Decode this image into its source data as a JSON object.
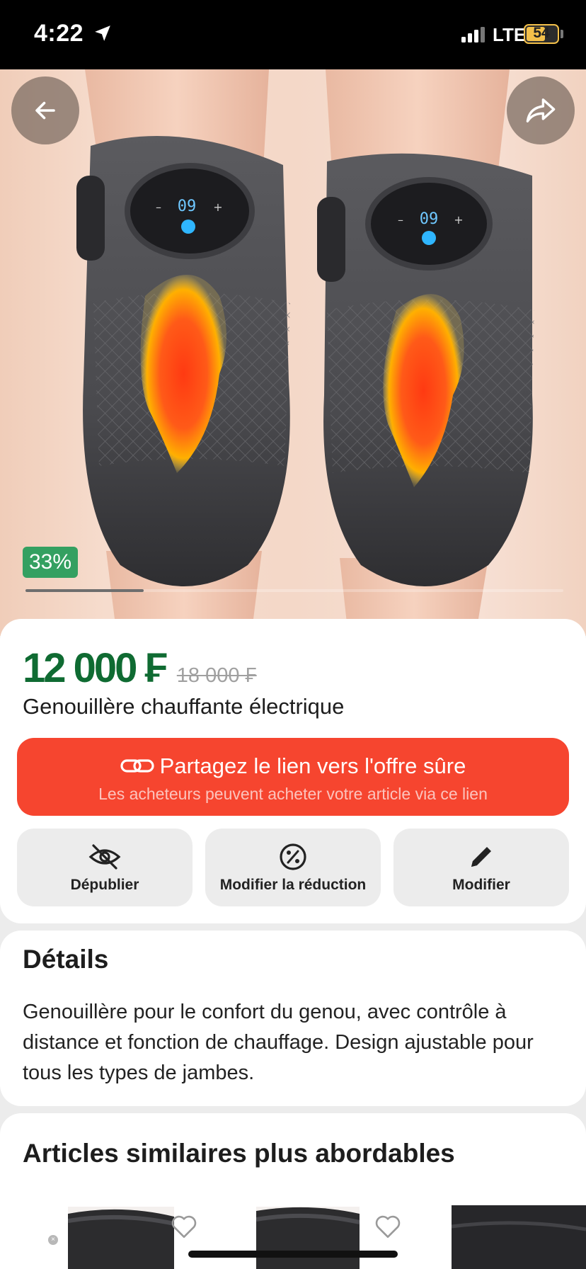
{
  "status_bar": {
    "time": "4:22",
    "network": "LTE",
    "battery": "54"
  },
  "hero": {
    "icons": {
      "back": "arrow-left-icon",
      "share": "share-arrow-icon"
    },
    "discount_badge": "33%",
    "gallery_progress": 0.22,
    "device_display_left": "09",
    "device_display_right": "09"
  },
  "product": {
    "price": "12 000 ₣",
    "old_price": "18 000 ₣",
    "title": "Genouillère chauffante électrique"
  },
  "share_cta": {
    "icon": "link-icon",
    "title": "Partagez le lien vers l'offre sûre",
    "subtitle": "Les acheteurs peuvent acheter votre article via ce lien"
  },
  "actions": [
    {
      "label": "Dépublier",
      "icon": "eye-off-icon"
    },
    {
      "label": "Modifier la réduction",
      "icon": "percent-icon"
    },
    {
      "label": "Modifier",
      "icon": "pencil-icon"
    }
  ],
  "details": {
    "title": "Détails",
    "text": "Genouillère pour le confort du genou, avec contrôle à distance et fonction de chauffage. Design ajustable pour tous les types de jambes."
  },
  "similar": {
    "title": "Articles similaires plus abordables",
    "icons": {
      "favorite": "heart-outline-icon"
    }
  },
  "colors": {
    "price_green": "#0f6b32",
    "cta_red": "#f6452f",
    "badge_green": "#34a061"
  }
}
